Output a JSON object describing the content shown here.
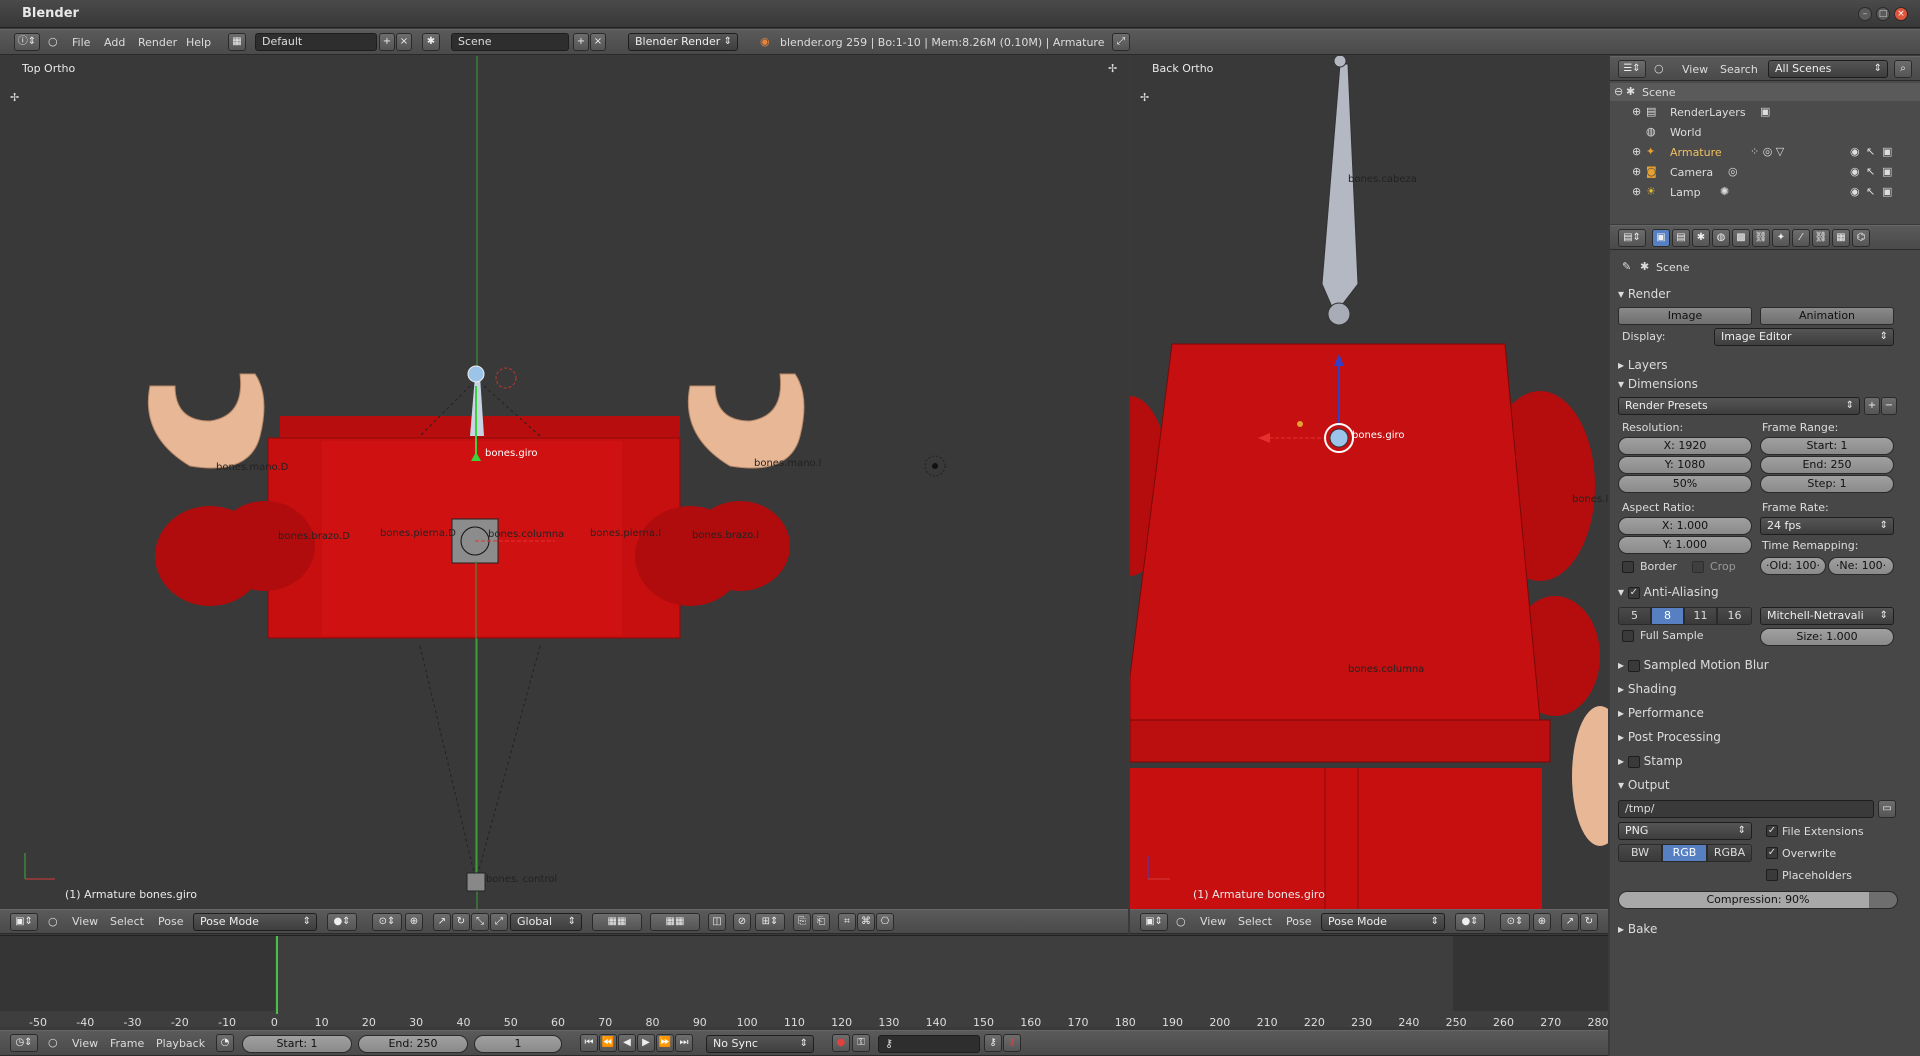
{
  "window": {
    "title": "Blender"
  },
  "info_header": {
    "menus": [
      "File",
      "Add",
      "Render",
      "Help"
    ],
    "layout": "Default",
    "scene": "Scene",
    "engine": "Blender Render",
    "stats": "blender.org 259 | Bo:1-10  | Mem:8.26M (0.10M) | Armature"
  },
  "viewport_left": {
    "label": "Top Ortho",
    "status": "(1) Armature bones.giro",
    "menus": [
      "View",
      "Select",
      "Pose"
    ],
    "mode": "Pose Mode",
    "orientation": "Global",
    "bones": {
      "giro": "bones.giro",
      "mano_d": "bones.mano.D",
      "mano_i": "bones.mano.I",
      "brazo_d": "bones.brazo.D",
      "brazo_i": "bones.brazo.I",
      "pierna_d": "bones.pierna.D",
      "columna": "bones.columna",
      "pierna_i": "bones.pierna.I",
      "control": "bones. control"
    }
  },
  "viewport_right": {
    "label": "Back Ortho",
    "status": "(1) Armature bones.giro",
    "menus": [
      "View",
      "Select",
      "Pose"
    ],
    "mode": "Pose Mode",
    "bones": {
      "cabeza": "bones.cabeza",
      "giro": "bones.giro",
      "columna": "bones.columna",
      "side": "bones.I"
    }
  },
  "outliner": {
    "menus": [
      "View",
      "Search"
    ],
    "filter": "All Scenes",
    "items": [
      "Scene",
      "RenderLayers",
      "World",
      "Armature",
      "Camera",
      "Lamp"
    ]
  },
  "properties": {
    "context": "Scene",
    "render": {
      "title": "Render",
      "image": "Image",
      "animation": "Animation",
      "display_label": "Display:",
      "display": "Image Editor"
    },
    "layers": "Layers",
    "dimensions": {
      "title": "Dimensions",
      "presets": "Render Presets",
      "resolution_label": "Resolution:",
      "res_x": "X: 1920",
      "res_y": "Y: 1080",
      "res_pct": "50%",
      "frame_range_label": "Frame Range:",
      "start": "Start: 1",
      "end": "End: 250",
      "step": "Step: 1",
      "aspect_label": "Aspect Ratio:",
      "asp_x": "X: 1.000",
      "asp_y": "Y: 1.000",
      "frame_rate_label": "Frame Rate:",
      "fps": "24 fps",
      "time_remap_label": "Time Remapping:",
      "old": "·Old: 100·",
      "new": "·Ne: 100·",
      "border": "Border",
      "crop": "Crop"
    },
    "aa": {
      "title": "Anti-Aliasing",
      "samples": [
        "5",
        "8",
        "11",
        "16"
      ],
      "filter": "Mitchell-Netravali",
      "full_sample": "Full Sample",
      "size": "Size: 1.000"
    },
    "panels": [
      "Sampled Motion Blur",
      "Shading",
      "Performance",
      "Post Processing",
      "Stamp"
    ],
    "output": {
      "title": "Output",
      "path": "/tmp/",
      "format": "PNG",
      "bw": "BW",
      "rgb": "RGB",
      "rgba": "RGBA",
      "file_ext": "File Extensions",
      "overwrite": "Overwrite",
      "placeholders": "Placeholders",
      "compression": "Compression: 90%"
    },
    "bake": "Bake"
  },
  "timeline": {
    "ticks": [
      "-50",
      "-40",
      "-30",
      "-20",
      "-10",
      "0",
      "10",
      "20",
      "30",
      "40",
      "50",
      "60",
      "70",
      "80",
      "90",
      "100",
      "110",
      "120",
      "130",
      "140",
      "150",
      "160",
      "170",
      "180",
      "190",
      "200",
      "210",
      "220",
      "230",
      "240",
      "250",
      "260",
      "270",
      "280"
    ],
    "menus": [
      "View",
      "Frame",
      "Playback"
    ],
    "start": "Start: 1",
    "end": "End: 250",
    "current": "1",
    "sync": "No Sync"
  },
  "colors": {
    "accent": "#5680c2",
    "red": "#c80f10",
    "skin": "#e8b896"
  }
}
